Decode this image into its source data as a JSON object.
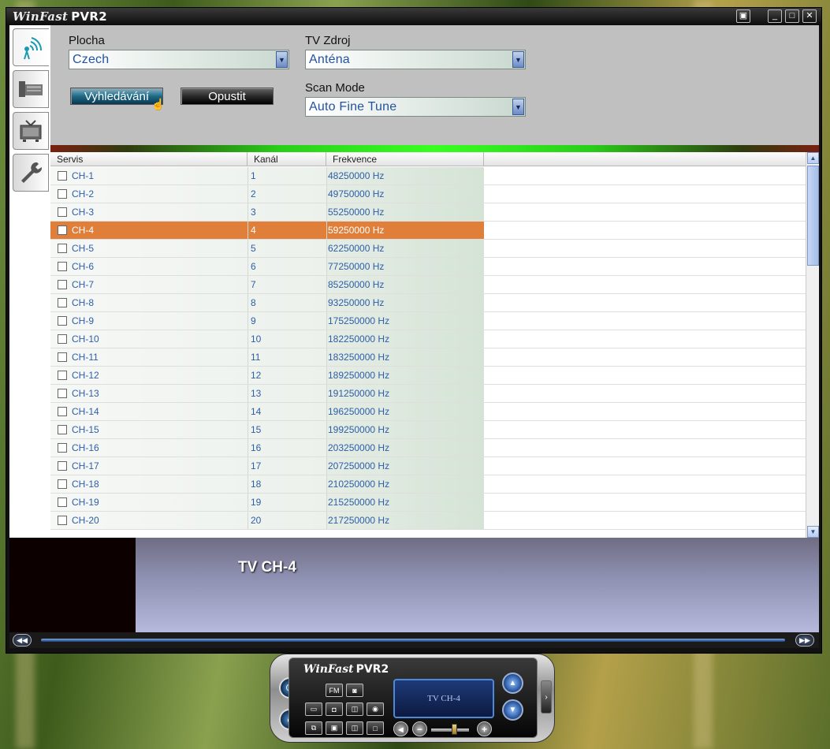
{
  "app": {
    "title": "WinFast",
    "title_suffix": "PVR2"
  },
  "window_buttons": [
    "▣",
    "_",
    "□",
    "✕"
  ],
  "settings": {
    "region_label": "Plocha",
    "region_value": "Czech",
    "source_label": "TV Zdroj",
    "source_value": "Anténa",
    "scan_mode_label": "Scan Mode",
    "scan_mode_value": "Auto Fine Tune",
    "search_button": "Vyhledávání",
    "exit_button": "Opustit"
  },
  "sidebar": {
    "items": [
      {
        "icon": "antenna-scan-icon",
        "active": true
      },
      {
        "icon": "tuner-device-icon",
        "active": false
      },
      {
        "icon": "tv-icon",
        "active": false
      },
      {
        "icon": "wrench-icon",
        "active": false
      }
    ]
  },
  "table": {
    "columns": [
      "Servis",
      "Kanál",
      "Frekvence"
    ],
    "selected_index": 3,
    "rows": [
      {
        "service": "CH-1",
        "channel": "1",
        "freq": "48250000 Hz"
      },
      {
        "service": "CH-2",
        "channel": "2",
        "freq": "49750000 Hz"
      },
      {
        "service": "CH-3",
        "channel": "3",
        "freq": "55250000 Hz"
      },
      {
        "service": "CH-4",
        "channel": "4",
        "freq": "59250000 Hz"
      },
      {
        "service": "CH-5",
        "channel": "5",
        "freq": "62250000 Hz"
      },
      {
        "service": "CH-6",
        "channel": "6",
        "freq": "77250000 Hz"
      },
      {
        "service": "CH-7",
        "channel": "7",
        "freq": "85250000 Hz"
      },
      {
        "service": "CH-8",
        "channel": "8",
        "freq": "93250000 Hz"
      },
      {
        "service": "CH-9",
        "channel": "9",
        "freq": "175250000 Hz"
      },
      {
        "service": "CH-10",
        "channel": "10",
        "freq": "182250000 Hz"
      },
      {
        "service": "CH-11",
        "channel": "11",
        "freq": "183250000 Hz"
      },
      {
        "service": "CH-12",
        "channel": "12",
        "freq": "189250000 Hz"
      },
      {
        "service": "CH-13",
        "channel": "13",
        "freq": "191250000 Hz"
      },
      {
        "service": "CH-14",
        "channel": "14",
        "freq": "196250000 Hz"
      },
      {
        "service": "CH-15",
        "channel": "15",
        "freq": "199250000 Hz"
      },
      {
        "service": "CH-16",
        "channel": "16",
        "freq": "203250000 Hz"
      },
      {
        "service": "CH-17",
        "channel": "17",
        "freq": "207250000 Hz"
      },
      {
        "service": "CH-18",
        "channel": "18",
        "freq": "210250000 Hz"
      },
      {
        "service": "CH-19",
        "channel": "19",
        "freq": "215250000 Hz"
      },
      {
        "service": "CH-20",
        "channel": "20",
        "freq": "217250000 Hz"
      }
    ]
  },
  "preview": {
    "now_playing": "TV CH-4"
  },
  "remote": {
    "title": "WinFast",
    "title_suffix": "PVR2",
    "fm_label": "FM",
    "display_text": "TV CH-4"
  },
  "colors": {
    "selected_row": "#e07f39",
    "text_blue": "#2d5ea8"
  }
}
